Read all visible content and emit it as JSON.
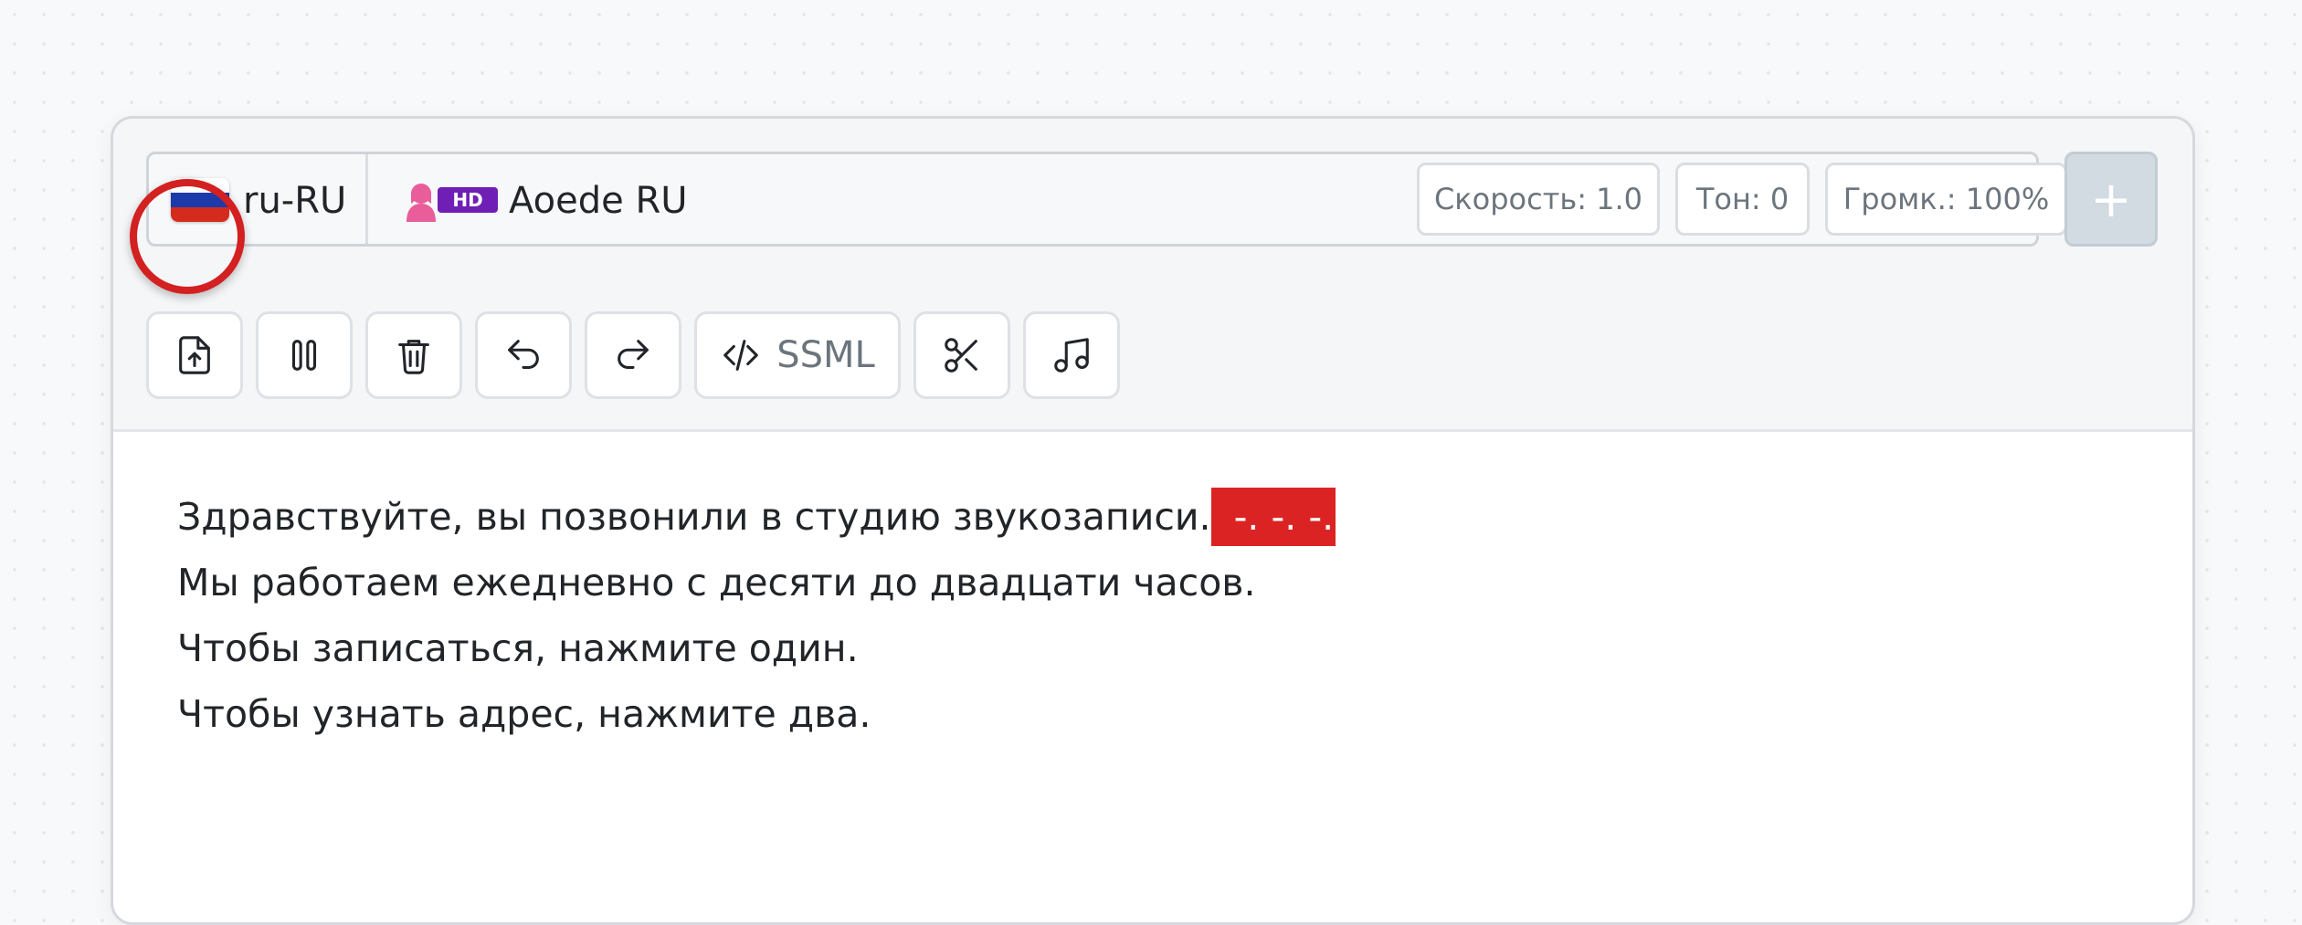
{
  "language": {
    "code": "ru-RU",
    "flag_colors": [
      "#ffffff",
      "#1c3aa9",
      "#d52b1e"
    ]
  },
  "voice": {
    "badge": "HD",
    "name": "Aoede RU",
    "icon": "female-voice-hd-icon",
    "icon_color": "#e85d9a",
    "badge_color": "#6f1fb5"
  },
  "params": {
    "speed": "Скорость: 1.0",
    "pitch": "Тон: 0",
    "volume": "Громк.: 100%"
  },
  "add_button": {
    "label": "+"
  },
  "toolbar": {
    "upload_icon": "file-upload-icon",
    "pause_icon": "pause-icon",
    "delete_icon": "trash-icon",
    "undo_icon": "undo-icon",
    "redo_icon": "redo-icon",
    "ssml_label": "SSML",
    "cut_icon": "scissors-icon",
    "music_icon": "music-note-icon",
    "highlighted": "pause-button",
    "highlight_color": "#d32020"
  },
  "editor": {
    "lines": [
      {
        "text": "Здравствуйте, вы позвонили в студию звукозаписи.",
        "marker": " -. -. -."
      },
      {
        "text": "Мы работаем ежедневно с десяти до двадцати часов."
      },
      {
        "text": "Чтобы записаться, нажмите один."
      },
      {
        "text": "Чтобы узнать адрес, нажмите два."
      }
    ],
    "marker_color": "#dc2323"
  }
}
